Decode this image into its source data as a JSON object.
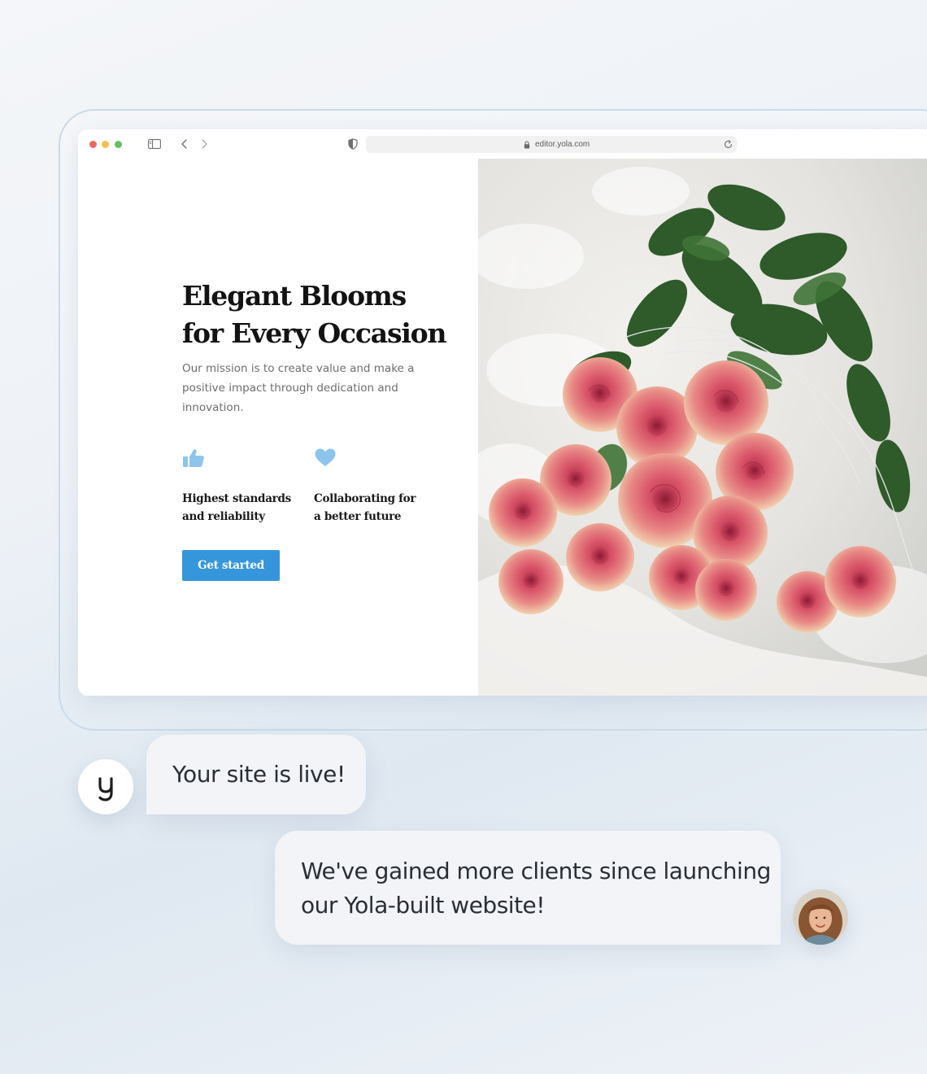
{
  "browser": {
    "url": "editor.yola.com",
    "icons": [
      "sidebar-icon",
      "chevron-left-icon",
      "chevron-right-icon",
      "shield-icon",
      "lock-icon",
      "reload-icon"
    ]
  },
  "hero": {
    "title_lines": [
      "Elegant Blooms",
      "for Every Occasion"
    ],
    "description": "Our mission is to create value and make a positive impact through dedication and innovation.",
    "features": [
      {
        "icon": "thumbs-up-icon",
        "lines": [
          "Highest standards",
          "and reliability"
        ]
      },
      {
        "icon": "heart-icon",
        "lines": [
          "Collaborating for",
          "a better future"
        ]
      }
    ],
    "cta_label": "Get started",
    "image": "rose-bouquet-photo"
  },
  "colors": {
    "accent": "#3596db",
    "icon_blue": "#8cc4ec",
    "title": "#131313",
    "body_text": "#6d6d6d",
    "bubble_bg": "#f2f4f7"
  },
  "chat": {
    "bot_avatar": "yola-logo-icon",
    "bot_message": "Your site is live!",
    "user_message_lines": [
      "We've gained more clients since launching",
      "our Yola-built website!"
    ],
    "user_avatar": "user-avatar-photo"
  }
}
